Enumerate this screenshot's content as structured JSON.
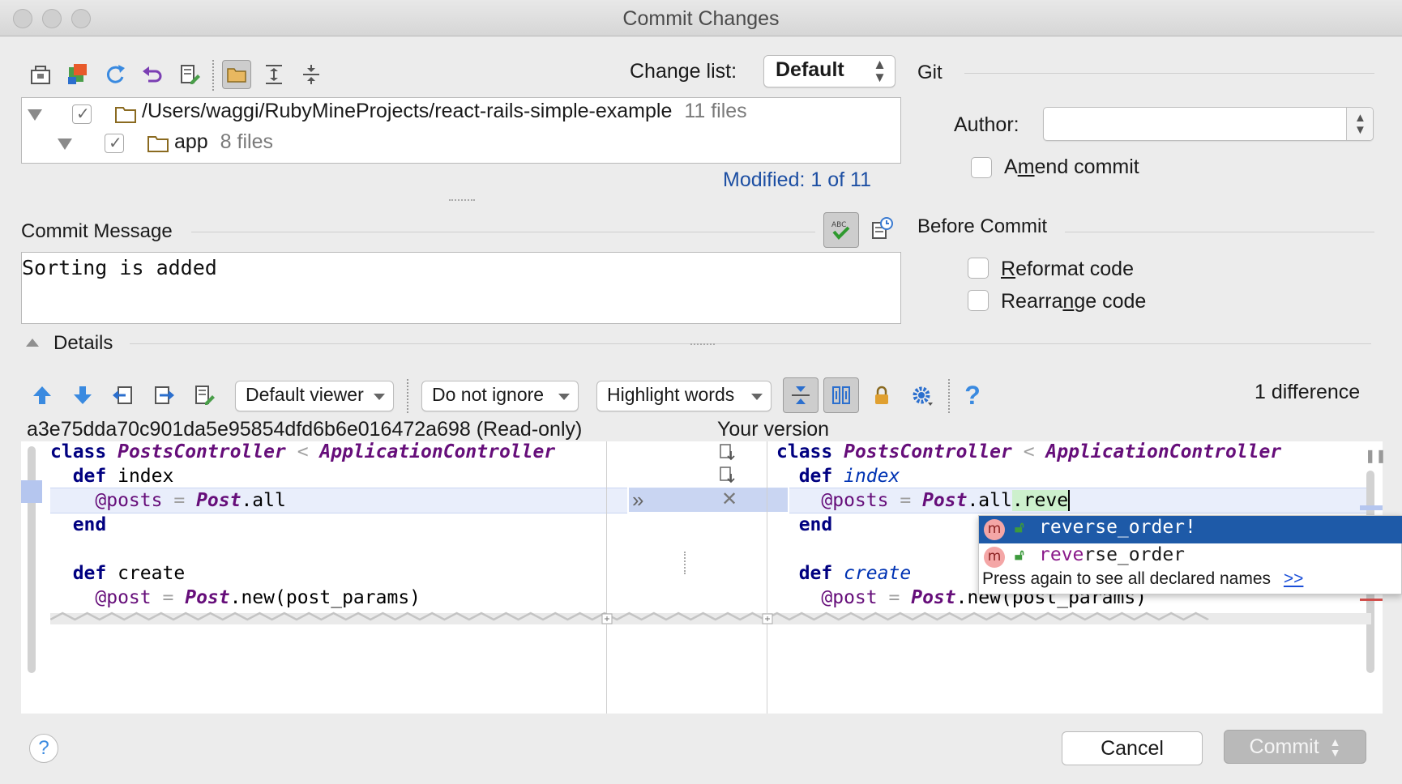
{
  "window": {
    "title": "Commit Changes"
  },
  "changes": {
    "change_list_label": "Change list:",
    "change_list_value": "Default",
    "tree": [
      {
        "path": "/Users/waggi/RubyMineProjects/react-rails-simple-example",
        "count": "11 files"
      },
      {
        "path": "app",
        "count": "8 files"
      }
    ],
    "modified": "Modified: 1 of 11"
  },
  "git": {
    "title": "Git",
    "author_label": "Author:",
    "author_value": "",
    "amend_prefix": "A",
    "amend_mnemonic": "m",
    "amend_suffix": "end commit"
  },
  "before_commit": {
    "title": "Before Commit",
    "reformat_mnemonic": "R",
    "reformat_rest": "eformat code",
    "rearrange_prefix": "Rearra",
    "rearrange_mnemonic": "n",
    "rearrange_suffix": "ge code"
  },
  "commit_message": {
    "label": "Commit Message",
    "text": "Sorting is added"
  },
  "details": {
    "label": "Details",
    "viewer": "Default viewer",
    "ignore": "Do not ignore",
    "highlight": "Highlight words",
    "difference_count": "1 difference",
    "left_title": "a3e75dda70c901da5e95854dfd6b6e016472a698 (Read-only)",
    "right_title": "Your version"
  },
  "completion": {
    "items": [
      "reverse_order!",
      "reverse_order"
    ],
    "hint": "Press again to see all declared names",
    "hint_link": ">>",
    "badge": "m"
  },
  "footer": {
    "cancel": "Cancel",
    "commit": "Commit"
  },
  "colors": {
    "accent_blue": "#1d4fa3",
    "selection": "#1e5aa8",
    "changed_line": "#e9eefb",
    "keyword": "#000080",
    "class_name": "#660e7a"
  }
}
